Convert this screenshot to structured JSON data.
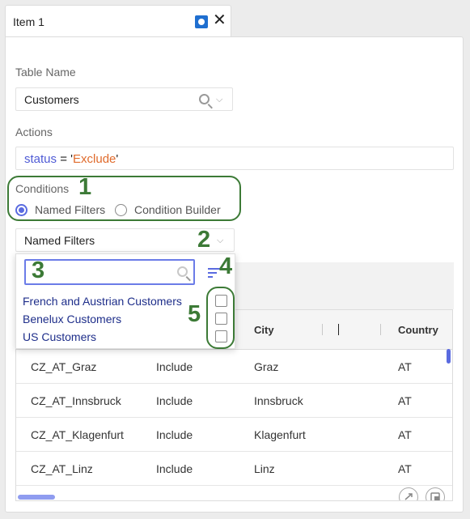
{
  "tab": {
    "title": "Item 1",
    "close_glyph": "✕"
  },
  "table_name": {
    "label": "Table Name",
    "value": "Customers"
  },
  "actions": {
    "label": "Actions",
    "field": "status",
    "op": " = ",
    "quote": "'",
    "value": "Exclude"
  },
  "conditions": {
    "label": "Conditions",
    "options": [
      {
        "label": "Named Filters",
        "selected": true
      },
      {
        "label": "Condition Builder",
        "selected": false
      }
    ]
  },
  "named_filters_select": {
    "value": "Named Filters"
  },
  "dropdown": {
    "search_placeholder": "",
    "items": [
      {
        "label": "French and Austrian Customers",
        "checked": false
      },
      {
        "label": "Benelux Customers",
        "checked": false
      },
      {
        "label": "US Customers",
        "checked": false
      }
    ]
  },
  "annotations": [
    "1",
    "2",
    "3",
    "4",
    "5"
  ],
  "grid": {
    "columns": [
      "City",
      "Country"
    ],
    "rows": [
      [
        "CZ_AT_Graz",
        "Include",
        "Graz",
        "AT"
      ],
      [
        "CZ_AT_Innsbruck",
        "Include",
        "Innsbruck",
        "AT"
      ],
      [
        "CZ_AT_Klagenfurt",
        "Include",
        "Klagenfurt",
        "AT"
      ],
      [
        "CZ_AT_Linz",
        "Include",
        "Linz",
        "AT"
      ]
    ]
  },
  "colors": {
    "accent": "#5a6be0",
    "annotation": "#3c7a36",
    "string": "#e06b2c"
  },
  "icons": [
    "close-icon",
    "pin-icon",
    "search-icon",
    "chevron-down-icon",
    "sort-icon",
    "expand-icon",
    "window-icon"
  ]
}
